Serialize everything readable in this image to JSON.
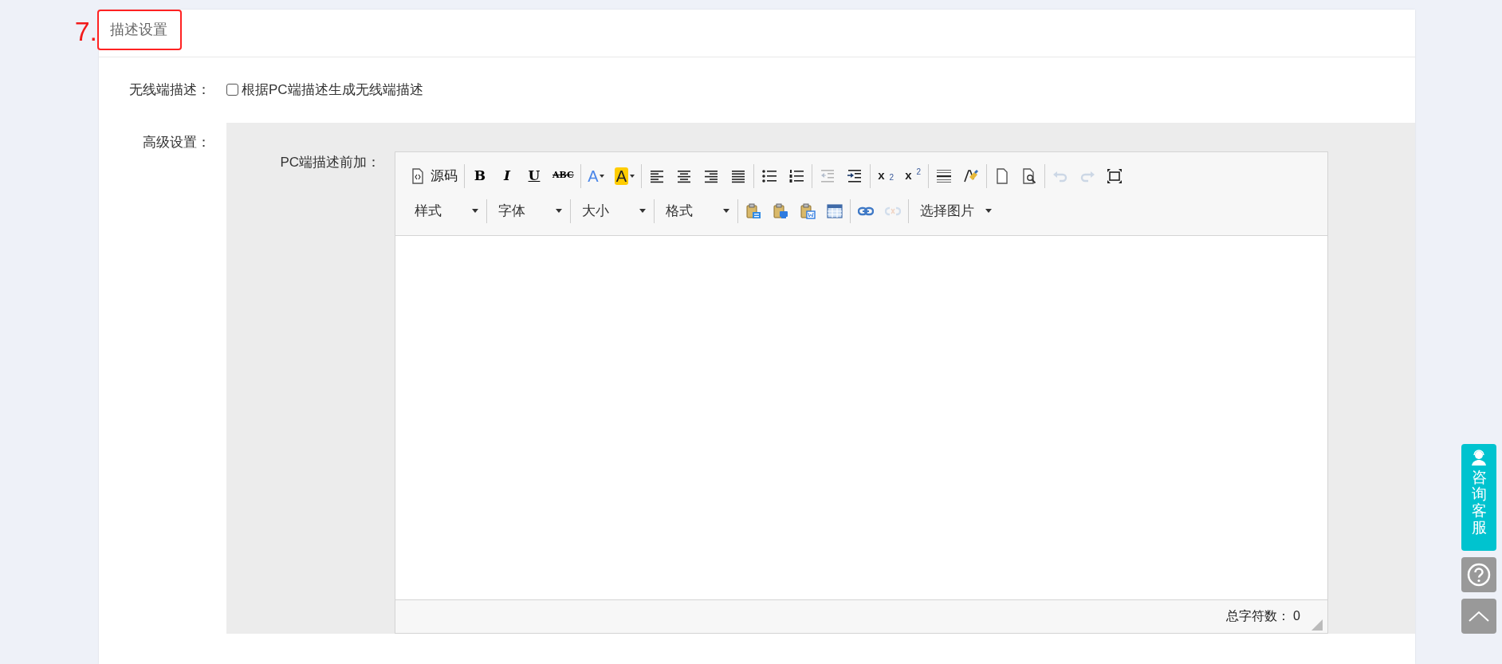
{
  "step_number": "7.",
  "section": {
    "title": "描述设置"
  },
  "wireless_description": {
    "label": "无线端描述：",
    "option": "根据PC端描述生成无线端描述",
    "checked": false
  },
  "advanced_settings": {
    "label": "高级设置：",
    "editor": {
      "label": "PC端描述前加：",
      "toolbar_rows": [
        [
          [
            {
              "kind": "source",
              "label": "源码",
              "disabled": false
            }
          ],
          [
            {
              "kind": "bold",
              "label": "B",
              "disabled": false
            },
            {
              "kind": "italic",
              "label": "I",
              "disabled": false
            },
            {
              "kind": "underline",
              "label": "U",
              "disabled": false
            },
            {
              "kind": "strike",
              "label": "ABC",
              "disabled": false
            }
          ],
          [
            {
              "kind": "forecolor",
              "label": "A",
              "disabled": false
            },
            {
              "kind": "backcolor",
              "label": "A",
              "disabled": false
            }
          ],
          [
            {
              "kind": "align-left",
              "disabled": false
            },
            {
              "kind": "align-center",
              "disabled": false
            },
            {
              "kind": "align-right",
              "disabled": false
            },
            {
              "kind": "justify",
              "disabled": false
            }
          ],
          [
            {
              "kind": "bullet-list",
              "disabled": false
            },
            {
              "kind": "number-list",
              "disabled": false
            }
          ],
          [
            {
              "kind": "outdent",
              "disabled": true
            },
            {
              "kind": "indent",
              "disabled": false
            }
          ],
          [
            {
              "kind": "subscript",
              "label": "x$_{2}$",
              "disabled": false
            },
            {
              "kind": "superscript",
              "label": "x$^{2}$",
              "disabled": false
            }
          ],
          [
            {
              "kind": "hr",
              "disabled": false
            },
            {
              "kind": "painter",
              "disabled": false
            }
          ],
          [
            {
              "kind": "new-doc",
              "disabled": false
            },
            {
              "kind": "preview",
              "disabled": false
            }
          ],
          [
            {
              "kind": "undo",
              "disabled": true
            },
            {
              "kind": "redo",
              "disabled": true
            },
            {
              "kind": "fullscreen",
              "disabled": false
            }
          ]
        ],
        [
          [
            {
              "kind": "dropdown",
              "label": "样式",
              "disabled": false
            }
          ],
          [
            {
              "kind": "dropdown",
              "label": "字体",
              "disabled": false
            }
          ],
          [
            {
              "kind": "dropdown",
              "label": "大小",
              "disabled": false
            }
          ],
          [
            {
              "kind": "dropdown",
              "label": "格式",
              "disabled": false
            }
          ],
          [
            {
              "kind": "paste",
              "disabled": false
            },
            {
              "kind": "paste-text",
              "disabled": false
            },
            {
              "kind": "paste-word",
              "disabled": false
            },
            {
              "kind": "table",
              "disabled": false
            }
          ],
          [
            {
              "kind": "link",
              "disabled": false
            },
            {
              "kind": "unlink",
              "disabled": true
            }
          ],
          [
            {
              "kind": "image-dropdown",
              "label": "选择图片",
              "disabled": false
            }
          ]
        ]
      ],
      "char_count_label": "总字符数：",
      "char_count": "0"
    }
  },
  "side_widgets": {
    "consult_label": "咨询客服"
  }
}
